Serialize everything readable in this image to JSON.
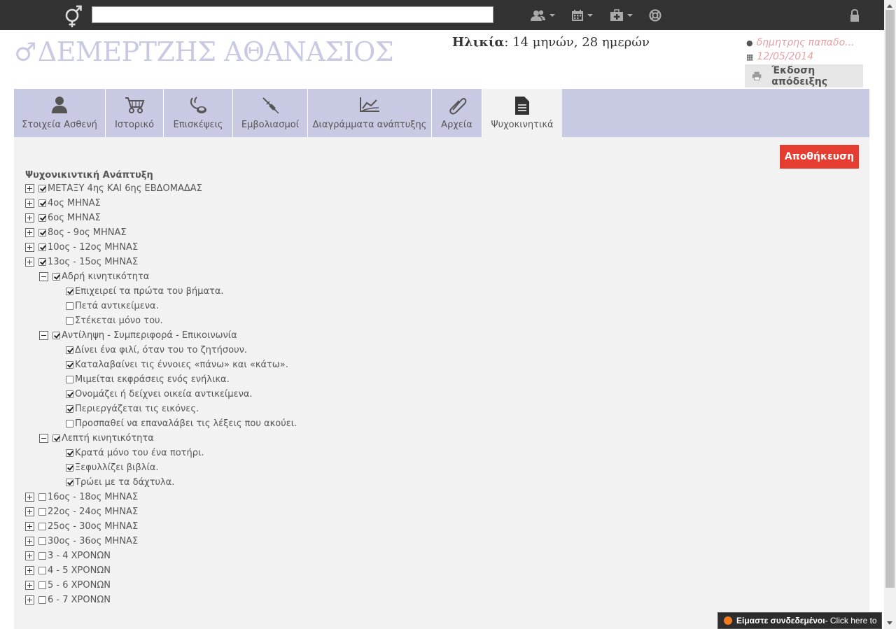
{
  "topbar": {
    "search_value": "",
    "menus": [
      {
        "icon": "users-icon"
      },
      {
        "icon": "calendar-icon"
      },
      {
        "icon": "medkit-icon"
      },
      {
        "icon": "lifebuoy-icon"
      }
    ],
    "lock_icon": "lock-icon"
  },
  "patient": {
    "gender_symbol": "♂",
    "name": "ΔΕΜΕΡΤΖΗΣ ΑΘΑΝΑΣΙΟΣ",
    "age_label": "Ηλικία",
    "age_value": ": 14 μηνών, 28 ημερών",
    "doctor": "δημητρης παπαδο...",
    "date": "12/05/2014"
  },
  "receipt_button": "Έκδοση απόδειξης",
  "tabs": [
    {
      "label": "Στοιχεία Ασθενή",
      "icon": "user-icon"
    },
    {
      "label": "Ιστορικό",
      "icon": "stroller-icon"
    },
    {
      "label": "Επισκέψεις",
      "icon": "stethoscope-icon"
    },
    {
      "label": "Εμβολιασμοί",
      "icon": "syringe-icon"
    },
    {
      "label": "Διαγράμματα ανάπτυξης",
      "icon": "chart-icon"
    },
    {
      "label": "Αρχεία",
      "icon": "paperclip-icon"
    },
    {
      "label": "Ψυχοκινητικά",
      "icon": "document-icon",
      "active": true
    }
  ],
  "save_button": "Αποθήκευση",
  "section_title": "Ψυχονικιντική Ανάπτυξη",
  "tree": [
    {
      "level": 0,
      "toggle": "plus",
      "checked": true,
      "label": "ΜΕΤΑΞΥ 4ης ΚΑΙ 6ης ΕΒΔΟΜΑΔΑΣ"
    },
    {
      "level": 0,
      "toggle": "plus",
      "checked": true,
      "label": "4ος ΜΗΝΑΣ"
    },
    {
      "level": 0,
      "toggle": "plus",
      "checked": true,
      "label": "6ος ΜΗΝΑΣ"
    },
    {
      "level": 0,
      "toggle": "plus",
      "checked": true,
      "label": "8ος - 9ος ΜΗΝΑΣ"
    },
    {
      "level": 0,
      "toggle": "plus",
      "checked": true,
      "label": "10ος - 12ος ΜΗΝΑΣ"
    },
    {
      "level": 0,
      "toggle": "plus",
      "checked": true,
      "label": "13ος - 15ος ΜΗΝΑΣ"
    },
    {
      "level": 1,
      "toggle": "minus",
      "checked": true,
      "label": "Αδρή κινητικότητα"
    },
    {
      "level": 2,
      "toggle": "none",
      "checked": true,
      "label": "Επιχειρεί τα πρώτα του βήματα."
    },
    {
      "level": 2,
      "toggle": "none",
      "checked": false,
      "label": "Πετά αντικείμενα."
    },
    {
      "level": 2,
      "toggle": "none",
      "checked": false,
      "label": "Στέκεται μόνο του."
    },
    {
      "level": 1,
      "toggle": "minus",
      "checked": true,
      "label": "Αντίληψη - Συμπεριφορά - Επικοινωνία"
    },
    {
      "level": 2,
      "toggle": "none",
      "checked": true,
      "label": "Δίνει ένα φιλί, όταν του το ζητήσουν."
    },
    {
      "level": 2,
      "toggle": "none",
      "checked": true,
      "label": "Καταλαβαίνει τις έννοιες «πάνω» και «κάτω»."
    },
    {
      "level": 2,
      "toggle": "none",
      "checked": false,
      "label": "Μιμείται εκφράσεις ενός ενήλικα."
    },
    {
      "level": 2,
      "toggle": "none",
      "checked": true,
      "label": "Ονομάζει ή δείχνει οικεία αντικείμενα."
    },
    {
      "level": 2,
      "toggle": "none",
      "checked": true,
      "label": "Περιεργάζεται τις εικόνες."
    },
    {
      "level": 2,
      "toggle": "none",
      "checked": false,
      "label": "Προσπαθεί να επαναλάβει τις λέξεις που ακούει."
    },
    {
      "level": 1,
      "toggle": "minus",
      "checked": true,
      "label": "Λεπτή κινητικότητα"
    },
    {
      "level": 2,
      "toggle": "none",
      "checked": true,
      "label": "Κρατά μόνο του ένα ποτήρι."
    },
    {
      "level": 2,
      "toggle": "none",
      "checked": true,
      "label": "Ξεφυλλίζει βιβλία."
    },
    {
      "level": 2,
      "toggle": "none",
      "checked": true,
      "label": "Τρώει με τα δάχτυλα."
    },
    {
      "level": 0,
      "toggle": "plus",
      "checked": false,
      "label": "16ος - 18ος ΜΗΝΑΣ"
    },
    {
      "level": 0,
      "toggle": "plus",
      "checked": false,
      "label": "22ος - 24ος ΜΗΝΑΣ"
    },
    {
      "level": 0,
      "toggle": "plus",
      "checked": false,
      "label": "25ος - 30ος ΜΗΝΑΣ"
    },
    {
      "level": 0,
      "toggle": "plus",
      "checked": false,
      "label": "30ος - 36ος ΜΗΝΑΣ"
    },
    {
      "level": 0,
      "toggle": "plus",
      "checked": false,
      "label": "3 - 4 ΧΡΟΝΩΝ"
    },
    {
      "level": 0,
      "toggle": "plus",
      "checked": false,
      "label": "4 - 5 ΧΡΟΝΩΝ"
    },
    {
      "level": 0,
      "toggle": "plus",
      "checked": false,
      "label": "5 - 6 ΧΡΟΝΩΝ"
    },
    {
      "level": 0,
      "toggle": "plus",
      "checked": false,
      "label": "6 - 7 ΧΡΟΝΩΝ"
    }
  ],
  "chat": {
    "status": "Είμαστε συνδεδεμένοι",
    "cta": " - Click here to"
  },
  "colors": {
    "topbar": "#333333",
    "tab_bar": "#c8c9e3",
    "save_button": "#e53d2f",
    "doctor_text": "#e3a0a4"
  }
}
